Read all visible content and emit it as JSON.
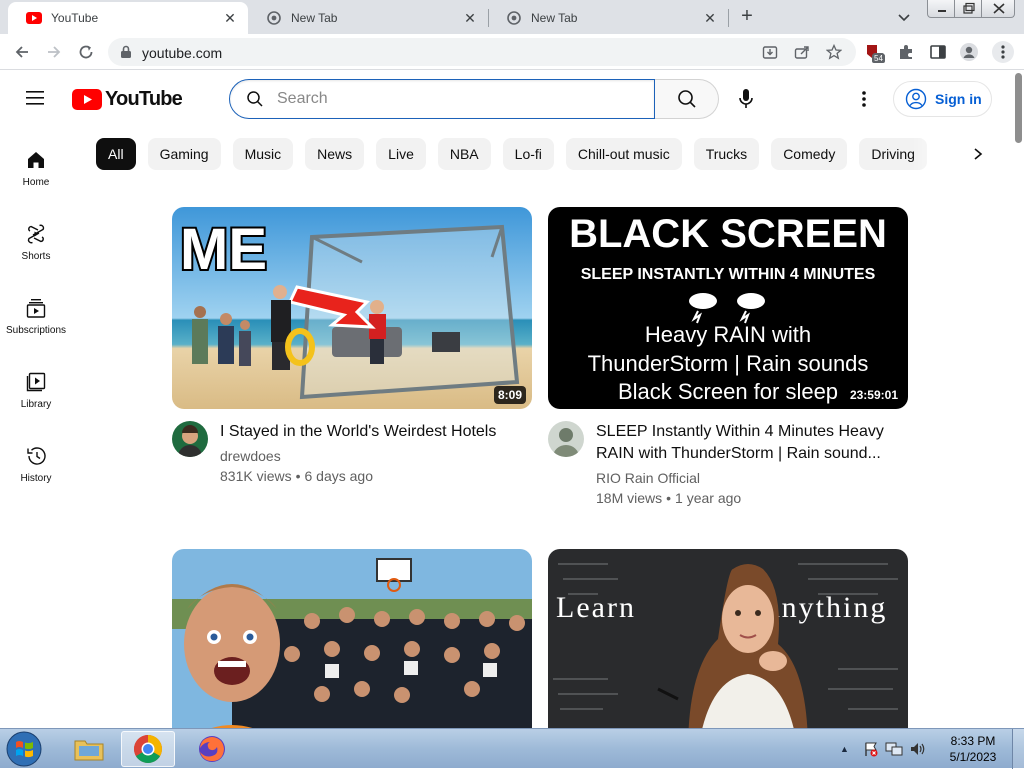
{
  "browser": {
    "tabs": [
      {
        "title": "YouTube",
        "active": true,
        "favicon": "youtube-favicon"
      },
      {
        "title": "New Tab",
        "active": false,
        "favicon": "chrome-favicon"
      },
      {
        "title": "New Tab",
        "active": false,
        "favicon": "chrome-favicon"
      }
    ],
    "new_tab_symbol": "+",
    "address": "youtube.com",
    "extension_badge": "54"
  },
  "youtube": {
    "logo_text": "YouTube",
    "search_placeholder": "Search",
    "sign_in_label": "Sign in",
    "chips": [
      "All",
      "Gaming",
      "Music",
      "News",
      "Live",
      "NBA",
      "Lo-fi",
      "Chill-out music",
      "Trucks",
      "Comedy",
      "Driving"
    ],
    "guide": [
      {
        "label": "Home",
        "icon": "home-icon"
      },
      {
        "label": "Shorts",
        "icon": "shorts-icon"
      },
      {
        "label": "Subscriptions",
        "icon": "subscriptions-icon"
      },
      {
        "label": "Library",
        "icon": "library-icon"
      },
      {
        "label": "History",
        "icon": "history-icon"
      }
    ],
    "videos": [
      {
        "title": "I Stayed in the World's Weirdest Hotels",
        "channel": "drewdoes",
        "views": "831K views",
        "age": "6 days ago",
        "duration": "8:09",
        "thumb_text": "ME"
      },
      {
        "title": "SLEEP Instantly Within 4 Minutes Heavy RAIN with ThunderStorm | Rain sound...",
        "channel": "RIO Rain Official",
        "views": "18M views",
        "age": "1 year ago",
        "duration": "23:59:01",
        "thumb_lines": [
          "BLACK SCREEN",
          "SLEEP INSTANTLY WITHIN 4 MINUTES",
          "Heavy RAIN with",
          "ThunderStorm | Rain sounds",
          "Black Screen for sleep"
        ]
      },
      {
        "title": "",
        "channel": "",
        "views": "",
        "age": "",
        "duration": ""
      },
      {
        "title": "",
        "channel": "",
        "views": "",
        "age": "",
        "duration": "",
        "thumb_text_left": "Learn",
        "thumb_text_right": "Anything"
      }
    ]
  },
  "taskbar": {
    "time": "8:33 PM",
    "date": "5/1/2023",
    "apps": [
      "windows-explorer",
      "google-chrome",
      "firefox"
    ]
  },
  "colors": {
    "youtube_red": "#ff0000",
    "link_blue": "#065fd4",
    "search_border": "#1c62b9"
  }
}
